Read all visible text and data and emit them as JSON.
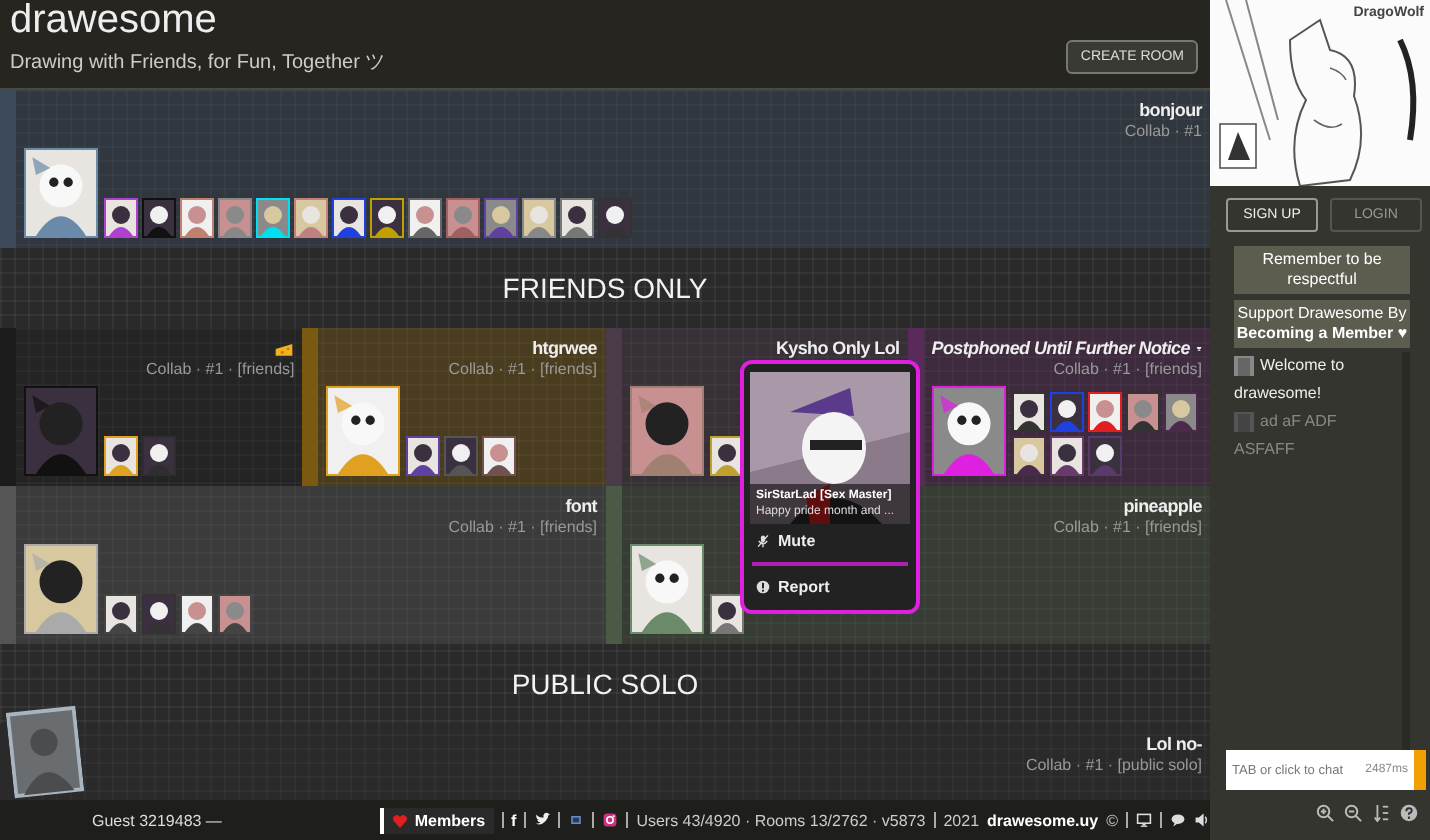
{
  "header": {
    "title": "drawesome",
    "tagline": "Drawing with Friends, for Fun, Together ツ",
    "create_button": "CREATE ROOM"
  },
  "lobby": {
    "sections": [
      {
        "rooms": [
          {
            "kind": "room",
            "title": "bonjour",
            "meta": "Collab · #1",
            "color": "#3d4a5c",
            "thumbs": [
              {
                "color": "#6a8aaa"
              },
              {
                "color": "#b040d0"
              },
              {
                "color": "#111111"
              },
              {
                "color": "#c08070"
              },
              {
                "color": "#888888"
              },
              {
                "color": "#00e0f0"
              },
              {
                "color": "#c08080"
              },
              {
                "color": "#2040e0"
              },
              {
                "color": "#c0a000"
              },
              {
                "color": "#666666"
              },
              {
                "color": "#a06060"
              },
              {
                "color": "#6040a0"
              },
              {
                "color": "#888888"
              },
              {
                "color": "#777777"
              },
              {
                "color": "#333333"
              }
            ]
          }
        ]
      },
      {
        "heading": "FRIENDS ONLY",
        "rooms": [
          {
            "kind": "emoji",
            "meta": "Collab · #1 · [friends]",
            "color": "#1c1c1c",
            "thumbs": [
              {
                "color": "#111111"
              },
              {
                "color": "#e0a020"
              },
              {
                "color": "#2e2e2e"
              }
            ]
          },
          {
            "kind": "room",
            "title": "htgrwee",
            "meta": "Collab · #1 · [friends]",
            "color": "#7a5a10",
            "thumbs": [
              {
                "color": "#e0a020"
              },
              {
                "color": "#6040a0"
              },
              {
                "color": "#555555"
              },
              {
                "color": "#705050"
              }
            ]
          },
          {
            "kind": "room",
            "title": "Kysho Only Lol",
            "color": "#4a3a4a",
            "thumbs": [
              {
                "color": "#a08070"
              },
              {
                "color": "#c0a030"
              }
            ]
          },
          {
            "kind": "announcement",
            "title": "Postphoned Until Further Notice",
            "meta": "Collab · #1 · [friends]",
            "color": "#5a2a5a",
            "thumbs": [
              {
                "color": "#e020e0"
              },
              {
                "color": "#333333"
              },
              {
                "color": "#2040e0"
              },
              {
                "color": "#e02020"
              },
              {
                "color": "#333333"
              },
              {
                "color": "#4a2a4a"
              },
              {
                "color": "#4a2a4a"
              },
              {
                "color": "#6a3a6a"
              },
              {
                "color": "#5a3a6a"
              }
            ]
          },
          {
            "kind": "room",
            "title": "font",
            "meta": "Collab · #1 · [friends]",
            "color": "#555555",
            "thumbs": [
              {
                "color": "#aaaaaa"
              },
              {
                "color": "#444444"
              },
              {
                "color": "#333333"
              },
              {
                "color": "#444444"
              },
              {
                "color": "#444444"
              }
            ]
          },
          {
            "kind": "room",
            "title": "pineapple",
            "meta": "Collab · #1 · [friends]",
            "color": "#4a5a44",
            "thumbs": [
              {
                "color": "#6a8a6a"
              },
              {
                "color": "#777777"
              }
            ]
          }
        ]
      },
      {
        "heading": "PUBLIC SOLO",
        "rooms": [
          {
            "kind": "room",
            "title": "Lol no-",
            "meta": "Collab · #1 · [public solo]",
            "color": "#2a2a2a"
          }
        ]
      }
    ],
    "popup": {
      "name": "SirStarLad [Sex Master]",
      "status": "Happy pride month and ...",
      "actions": [
        {
          "kind": "mute",
          "label": "Mute"
        },
        {
          "kind": "report",
          "label": "Report"
        }
      ]
    }
  },
  "footer": {
    "guest": "Guest 3219483 —",
    "members": "Members",
    "facebook": "f",
    "stats": "Users 43/4920 · Rooms 13/2762 · v5873",
    "year": "2021",
    "site": "drawesome.uy",
    "copyright": "©"
  },
  "sidebar": {
    "preview_artist": "DragoWolf",
    "sign_up": "SIGN UP",
    "login": "LOGIN",
    "notices": [
      "Remember to be respectful",
      "Support Drawesome By **Becoming a Member** ♥"
    ],
    "messages": [
      {
        "text": "Welcome to drawesome!",
        "dim": false
      },
      {
        "text": "ad aF ADF ASFAFF",
        "dim": true
      }
    ],
    "chat_placeholder": "TAB or click to chat",
    "ping": "2487ms"
  }
}
